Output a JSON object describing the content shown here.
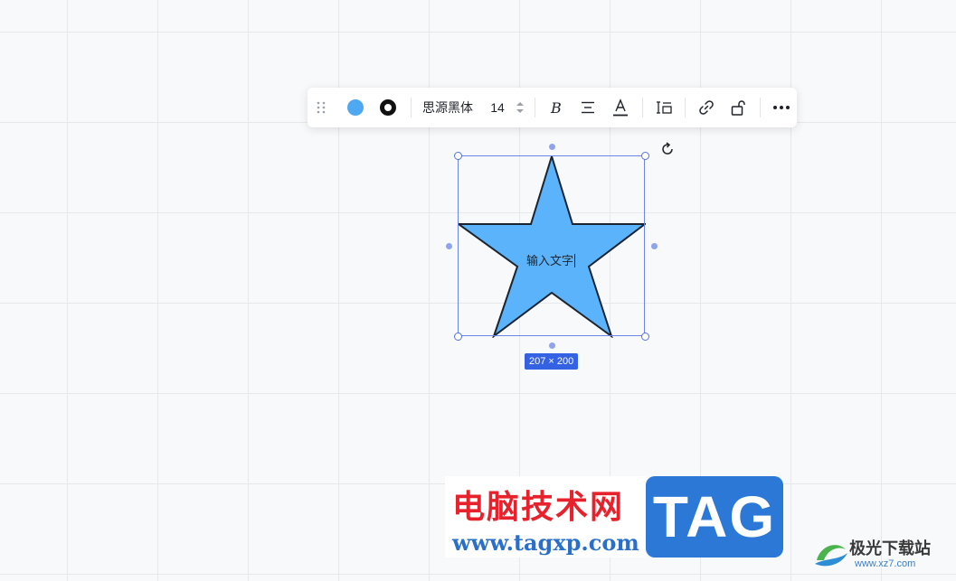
{
  "toolbar": {
    "font_name": "思源黑体",
    "font_size": "14",
    "fill_color": "#4ea8f2",
    "stroke_color": "#111111",
    "icons": [
      "drag-handle-icon",
      "fill-color-icon",
      "stroke-color-icon",
      "stepper-icon",
      "bold-icon",
      "align-icon",
      "text-color-icon",
      "line-spacing-icon",
      "link-icon",
      "unlock-icon",
      "more-icon"
    ]
  },
  "shape": {
    "type": "star",
    "fill": "#5bb4fb",
    "text": "输入文字",
    "size_label": "207 × 200"
  },
  "watermark": {
    "title": "电脑技术网",
    "url": "www.tagxp.com",
    "tag": "TAG",
    "site_name": "极光下载站",
    "site_url": "www.xz7.com"
  }
}
